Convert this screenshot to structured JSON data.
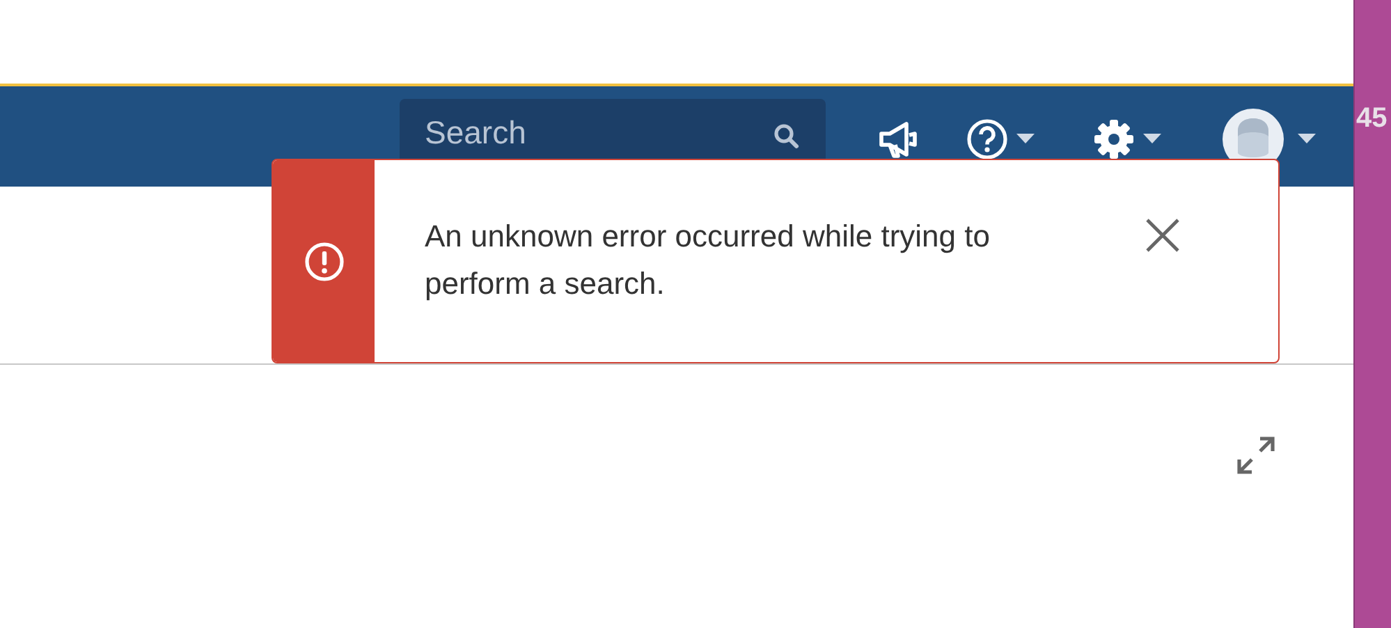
{
  "search": {
    "placeholder": "Search"
  },
  "edge_text": "45",
  "notification": {
    "kind": "error",
    "message": "An unknown error occurred while trying to perform a search."
  }
}
